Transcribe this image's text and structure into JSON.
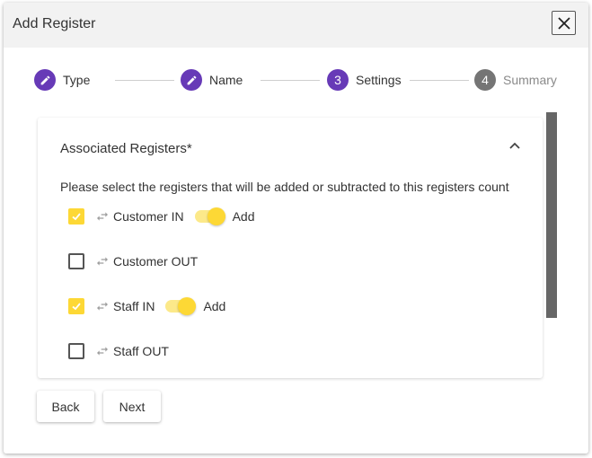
{
  "dialog": {
    "title": "Add Register",
    "close_icon": "close-icon"
  },
  "stepper": {
    "steps": [
      {
        "label": "Type",
        "icon": "pencil-icon",
        "state": "completed"
      },
      {
        "label": "Name",
        "icon": "pencil-icon",
        "state": "completed"
      },
      {
        "label": "Settings",
        "number": "3",
        "state": "active"
      },
      {
        "label": "Summary",
        "number": "4",
        "state": "inactive"
      }
    ]
  },
  "panel": {
    "title": "Associated Registers*",
    "collapse_icon": "chevron-up-icon",
    "instruction": "Please select the registers that will be added or subtracted to this registers count",
    "registers": [
      {
        "label": "Customer IN",
        "checked": true,
        "toggle_label": "Add"
      },
      {
        "label": "Customer OUT",
        "checked": false
      },
      {
        "label": "Staff IN",
        "checked": true,
        "toggle_label": "Add"
      },
      {
        "label": "Staff OUT",
        "checked": false
      }
    ]
  },
  "footer": {
    "back_label": "Back",
    "next_label": "Next"
  },
  "colors": {
    "accent": "#673ab7",
    "inactive_step": "#757575",
    "checkbox_checked": "#fdd835",
    "toggle_thumb": "#fdd835",
    "toggle_track": "#fce98a"
  }
}
